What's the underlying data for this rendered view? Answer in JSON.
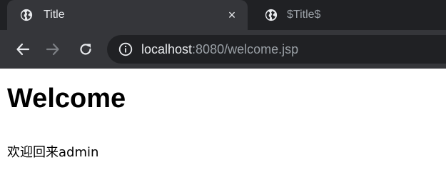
{
  "browser": {
    "tabs": [
      {
        "title": "Title",
        "active": true,
        "icon": "globe-icon",
        "close_label": "×"
      },
      {
        "title": "$Title$",
        "active": false,
        "icon": "globe-icon"
      }
    ],
    "toolbar": {
      "back_icon": "arrow-left-icon",
      "forward_icon": "arrow-right-icon",
      "reload_icon": "reload-icon",
      "site_info_icon": "info-icon",
      "url_host": "localhost",
      "url_rest": ":8080/welcome.jsp"
    },
    "colors": {
      "tabstrip": "#202124",
      "active_tab": "#35363a",
      "omnibox": "#202124",
      "text_light": "#e8eaed",
      "text_dim": "#9aa0a6"
    }
  },
  "page": {
    "heading": "Welcome",
    "message": "欢迎回来admin"
  }
}
